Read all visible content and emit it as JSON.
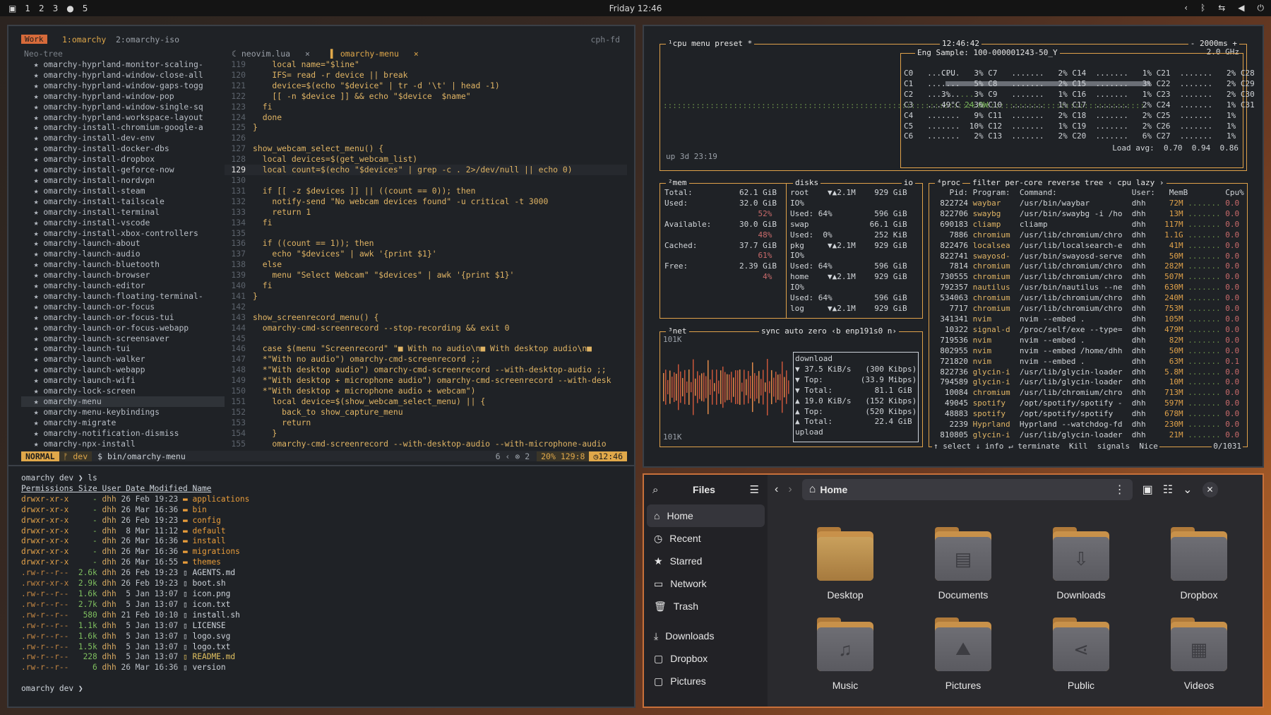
{
  "topbar": {
    "workspaces": [
      "1",
      "2",
      "3",
      "●",
      "5"
    ],
    "clock": "Friday 12:46",
    "tray": [
      "‹",
      "ᛒ",
      "⇆",
      "◀",
      "⏻"
    ]
  },
  "nvim": {
    "session_label": "Work",
    "window1": "1:omarchy",
    "window2": "2:omarchy-iso",
    "host": "cph-fd",
    "tree_title": "Neo-tree",
    "tabs": [
      {
        "label": "neovim.lua",
        "close": "×"
      },
      {
        "label": "omarchy-menu",
        "close": "×"
      }
    ],
    "tree": [
      "★ omarchy-hyprland-monitor-scaling-",
      "★ omarchy-hyprland-window-close-all",
      "★ omarchy-hyprland-window-gaps-togg",
      "★ omarchy-hyprland-window-pop",
      "★ omarchy-hyprland-window-single-sq",
      "★ omarchy-hyprland-workspace-layout",
      "★ omarchy-install-chromium-google-a",
      "★ omarchy-install-dev-env",
      "★ omarchy-install-docker-dbs",
      "★ omarchy-install-dropbox",
      "★ omarchy-install-geforce-now",
      "★ omarchy-install-nordvpn",
      "★ omarchy-install-steam",
      "★ omarchy-install-tailscale",
      "★ omarchy-install-terminal",
      "★ omarchy-install-vscode",
      "★ omarchy-install-xbox-controllers",
      "★ omarchy-launch-about",
      "★ omarchy-launch-audio",
      "★ omarchy-launch-bluetooth",
      "★ omarchy-launch-browser",
      "★ omarchy-launch-editor",
      "★ omarchy-launch-floating-terminal-",
      "★ omarchy-launch-or-focus",
      "★ omarchy-launch-or-focus-tui",
      "★ omarchy-launch-or-focus-webapp",
      "★ omarchy-launch-screensaver",
      "★ omarchy-launch-tui",
      "★ omarchy-launch-walker",
      "★ omarchy-launch-webapp",
      "★ omarchy-launch-wifi",
      "★ omarchy-lock-screen",
      "★ omarchy-menu",
      "★ omarchy-menu-keybindings",
      "★ omarchy-migrate",
      "★ omarchy-notification-dismiss",
      "★ omarchy-npx-install"
    ],
    "code": [
      {
        "n": "119",
        "t": "    local name=\"$line\""
      },
      {
        "n": "120",
        "t": "    IFS= read -r device || break"
      },
      {
        "n": "121",
        "t": "    device=$(echo \"$device\" | tr -d '\\t' | head -1)"
      },
      {
        "n": "122",
        "t": "    [[ -n $device ]] && echo \"$device  $name\""
      },
      {
        "n": "123",
        "t": "  fi"
      },
      {
        "n": "124",
        "t": "  done"
      },
      {
        "n": "125",
        "t": "}"
      },
      {
        "n": "126",
        "t": ""
      },
      {
        "n": "127",
        "t": "show_webcam_select_menu() {"
      },
      {
        "n": "128",
        "t": "  local devices=$(get_webcam_list)"
      },
      {
        "n": "129",
        "t": "  local count=$(echo \"$devices\" | grep -c . 2>/dev/null || echo 0)"
      },
      {
        "n": "130",
        "t": ""
      },
      {
        "n": "131",
        "t": "  if [[ -z $devices ]] || ((count == 0)); then"
      },
      {
        "n": "132",
        "t": "    notify-send \"No webcam devices found\" -u critical -t 3000"
      },
      {
        "n": "133",
        "t": "    return 1"
      },
      {
        "n": "134",
        "t": "  fi"
      },
      {
        "n": "135",
        "t": ""
      },
      {
        "n": "136",
        "t": "  if ((count == 1)); then"
      },
      {
        "n": "137",
        "t": "    echo \"$devices\" | awk '{print $1}'"
      },
      {
        "n": "138",
        "t": "  else"
      },
      {
        "n": "139",
        "t": "    menu \"Select Webcam\" \"$devices\" | awk '{print $1}'"
      },
      {
        "n": "140",
        "t": "  fi"
      },
      {
        "n": "141",
        "t": "}"
      },
      {
        "n": "142",
        "t": ""
      },
      {
        "n": "143",
        "t": "show_screenrecord_menu() {"
      },
      {
        "n": "144",
        "t": "  omarchy-cmd-screenrecord --stop-recording && exit 0"
      },
      {
        "n": "145",
        "t": ""
      },
      {
        "n": "146",
        "t": "  case $(menu \"Screenrecord\" \"■ With no audio\\n■ With desktop audio\\n■"
      },
      {
        "n": "147",
        "t": "  *\"With no audio\") omarchy-cmd-screenrecord ;;"
      },
      {
        "n": "148",
        "t": "  *\"With desktop audio\") omarchy-cmd-screenrecord --with-desktop-audio ;;"
      },
      {
        "n": "149",
        "t": "  *\"With desktop + microphone audio\") omarchy-cmd-screenrecord --with-desk"
      },
      {
        "n": "150",
        "t": "  *\"With desktop + microphone audio + webcam\")"
      },
      {
        "n": "151",
        "t": "    local device=$(show_webcam_select_menu) || {"
      },
      {
        "n": "152",
        "t": "      back_to show_capture_menu"
      },
      {
        "n": "153",
        "t": "      return"
      },
      {
        "n": "154",
        "t": "    }"
      },
      {
        "n": "155",
        "t": "    omarchy-cmd-screenrecord --with-desktop-audio --with-microphone-audio"
      }
    ],
    "status": {
      "mode": "NORMAL",
      "branch": "ᚠ dev",
      "file": "$  bin/omarchy-menu",
      "diag": "6 ‹ ⊗ 2",
      "pos": "20%  129:8",
      "time": "12:46"
    }
  },
  "terminal": {
    "prompt1": "omarchy dev ❯ ls",
    "headers": [
      "Permissions",
      "Size",
      "User",
      "Date Modified",
      "Name"
    ],
    "rows": [
      [
        "drwxr-xr-x",
        "-",
        "dhh",
        "26 Feb 19:23",
        "applications"
      ],
      [
        "drwxr-xr-x",
        "-",
        "dhh",
        "26 Mar 16:36",
        "bin"
      ],
      [
        "drwxr-xr-x",
        "-",
        "dhh",
        "26 Feb 19:23",
        "config"
      ],
      [
        "drwxr-xr-x",
        "-",
        "dhh",
        " 8 Mar 11:12",
        "default"
      ],
      [
        "drwxr-xr-x",
        "-",
        "dhh",
        "26 Mar 16:36",
        "install"
      ],
      [
        "drwxr-xr-x",
        "-",
        "dhh",
        "26 Mar 16:36",
        "migrations"
      ],
      [
        "drwxr-xr-x",
        "-",
        "dhh",
        "26 Mar 16:55",
        "themes"
      ],
      [
        ".rw-r--r--",
        "2.6k",
        "dhh",
        "26 Feb 19:23",
        "AGENTS.md"
      ],
      [
        ".rwxr-xr-x",
        "2.9k",
        "dhh",
        "26 Feb 19:23",
        "boot.sh"
      ],
      [
        ".rw-r--r--",
        "1.6k",
        "dhh",
        " 5 Jan 13:07",
        "icon.png"
      ],
      [
        ".rw-r--r--",
        "2.7k",
        "dhh",
        " 5 Jan 13:07",
        "icon.txt"
      ],
      [
        ".rw-r--r--",
        "580",
        "dhh",
        "21 Feb 10:10",
        "install.sh"
      ],
      [
        ".rw-r--r--",
        "1.1k",
        "dhh",
        " 5 Jan 13:07",
        "LICENSE"
      ],
      [
        ".rw-r--r--",
        "1.6k",
        "dhh",
        " 5 Jan 13:07",
        "logo.svg"
      ],
      [
        ".rw-r--r--",
        "1.5k",
        "dhh",
        " 5 Jan 13:07",
        "logo.txt"
      ],
      [
        ".rw-r--r--",
        "228",
        "dhh",
        " 5 Jan 13:07",
        "README.md"
      ],
      [
        ".rw-r--r--",
        "6",
        "dhh",
        "26 Mar 16:36",
        "version"
      ]
    ],
    "prompt2": "omarchy dev ❯"
  },
  "btop": {
    "cpu_title": "¹cpu",
    "menu_label": "menu",
    "preset_label": "preset *",
    "time": "12:46:42",
    "interval": "- 2000ms +",
    "freq": "2.0 GHz",
    "cpu_model": "Eng Sample: 100-000001243-50_Y",
    "cpu_total": "CPU",
    "cpu_pct": "3%",
    "cpu_temp": "49°C",
    "cpu_power": "24.0W",
    "cores": [
      [
        "C0",
        "3%",
        "C7",
        "2%",
        "C14",
        "1%",
        "C21",
        "2%",
        "C28",
        "1%"
      ],
      [
        "C1",
        "5%",
        "C8",
        "2%",
        "C15",
        "3%",
        "C22",
        "2%",
        "C29",
        "2%"
      ],
      [
        "C2",
        "3%",
        "C9",
        "1%",
        "C16",
        "1%",
        "C23",
        "2%",
        "C30",
        "2%"
      ],
      [
        "C3",
        "3%",
        "C10",
        "1%",
        "C17",
        "2%",
        "C24",
        "1%",
        "C31",
        "2%"
      ],
      [
        "C4",
        "9%",
        "C11",
        "2%",
        "C18",
        "2%",
        "C25",
        "1%",
        "",
        ""
      ],
      [
        "C5",
        "10%",
        "C12",
        "1%",
        "C19",
        "2%",
        "C26",
        "1%",
        "",
        ""
      ],
      [
        "C6",
        "2%",
        "C13",
        "2%",
        "C20",
        "6%",
        "C27",
        "1%",
        "",
        ""
      ]
    ],
    "loadavg": "Load avg:  0.70  0.94  0.86",
    "uptime": "up 3d 23:19",
    "mem_title": "²mem",
    "mem": [
      "Total:          62.1 GiB",
      "Used:           32.0 GiB",
      "                    52%",
      "Available:      30.0 GiB",
      "                    48%",
      "Cached:         37.7 GiB",
      "                    61%",
      "Free:           2.39 GiB",
      "                     4%"
    ],
    "disks_title": "disks",
    "io_label": "io",
    "disks": [
      "root    ▼▲2.1M    929 GiB",
      "IO%",
      "Used: 64%         596 GiB",
      "swap             66.1 GiB",
      "Used:  0%         252 KiB",
      "pkg     ▼▲2.1M    929 GiB",
      "IO%",
      "Used: 64%         596 GiB",
      "home    ▼▲2.1M    929 GiB",
      "IO%",
      "Used: 64%         596 GiB",
      "log     ▼▲2.1M    929 GiB"
    ],
    "net_title": "³net",
    "net_opts": "sync auto zero ‹b enp191s0 n›",
    "net_scale": "101K",
    "net_scale2": "101K",
    "net": [
      "download",
      "▼ 37.5 KiB/s   (300 Kibps)",
      "▼ Top:        (33.9 Mibps)",
      "▼ Total:         81.1 GiB",
      "",
      "▲ 19.0 KiB/s   (152 Kibps)",
      "▲ Top:         (520 Kibps)",
      "▲ Total:         22.4 GiB",
      "upload"
    ],
    "proc_title": "⁴proc",
    "proc_opts": "filter   per-core reverse tree ‹ cpu lazy ›",
    "proc_header": "    Pid: Program:  Command:                User:   MemB        Cpu%",
    "procs": [
      [
        "822724",
        "waybar",
        "/usr/bin/waybar",
        "dhh",
        "72M",
        "0.0"
      ],
      [
        "822706",
        "swaybg",
        "/usr/bin/swaybg -i /ho",
        "dhh",
        "13M",
        "0.0"
      ],
      [
        "690183",
        "cliamp",
        "cliamp",
        "dhh",
        "117M",
        "0.0"
      ],
      [
        "7886",
        "chromium",
        "/usr/lib/chromium/chro",
        "dhh",
        "1.1G",
        "0.0"
      ],
      [
        "822476",
        "localsea",
        "/usr/lib/localsearch-e",
        "dhh",
        "41M",
        "0.0"
      ],
      [
        "822741",
        "swayosd-",
        "/usr/bin/swayosd-serve",
        "dhh",
        "50M",
        "0.0"
      ],
      [
        "7814",
        "chromium",
        "/usr/lib/chromium/chro",
        "dhh",
        "282M",
        "0.0"
      ],
      [
        "730555",
        "chromium",
        "/usr/lib/chromium/chro",
        "dhh",
        "507M",
        "0.0"
      ],
      [
        "792357",
        "nautilus",
        "/usr/bin/nautilus --ne",
        "dhh",
        "630M",
        "0.0"
      ],
      [
        "534063",
        "chromium",
        "/usr/lib/chromium/chro",
        "dhh",
        "240M",
        "0.0"
      ],
      [
        "7717",
        "chromium",
        "/usr/lib/chromium/chro",
        "dhh",
        "753M",
        "0.0"
      ],
      [
        "341341",
        "nvim",
        "nvim --embed .",
        "dhh",
        "105M",
        "0.0"
      ],
      [
        "10322",
        "signal-d",
        "/proc/self/exe --type=",
        "dhh",
        "479M",
        "0.0"
      ],
      [
        "719536",
        "nvim",
        "nvim --embed .",
        "dhh",
        "82M",
        "0.0"
      ],
      [
        "802955",
        "nvim",
        "nvim --embed /home/dhh",
        "dhh",
        "50M",
        "0.0"
      ],
      [
        "721820",
        "nvim",
        "nvim --embed .",
        "dhh",
        "63M",
        "0.1"
      ],
      [
        "822736",
        "glycin-i",
        "/usr/lib/glycin-loader",
        "dhh",
        "5.8M",
        "0.0"
      ],
      [
        "794589",
        "glycin-i",
        "/usr/lib/glycin-loader",
        "dhh",
        "10M",
        "0.0"
      ],
      [
        "10084",
        "chromium",
        "/usr/lib/chromium/chro",
        "dhh",
        "713M",
        "0.0"
      ],
      [
        "49045",
        "spotify",
        "/opt/spotify/spotify -",
        "dhh",
        "597M",
        "0.0"
      ],
      [
        "48883",
        "spotify",
        "/opt/spotify/spotify",
        "dhh",
        "678M",
        "0.0"
      ],
      [
        "2239",
        "Hyprland",
        "Hyprland --watchdog-fd",
        "dhh",
        "230M",
        "0.0"
      ],
      [
        "810805",
        "glycin-i",
        "/usr/lib/glycin-loader",
        "dhh",
        "21M",
        "0.0"
      ]
    ],
    "proc_footer": "↑ select ↓ info ↵ terminate  Kill  signals  Nice",
    "proc_count": "0/1031"
  },
  "files": {
    "title": "Files",
    "path": "Home",
    "sidebar": [
      {
        "icon": "⌂",
        "label": "Home"
      },
      {
        "icon": "◷",
        "label": "Recent"
      },
      {
        "icon": "★",
        "label": "Starred"
      },
      {
        "icon": "▭",
        "label": "Network"
      },
      {
        "icon": "🗑",
        "label": "Trash"
      },
      {
        "icon": "⤓",
        "label": "Downloads"
      },
      {
        "icon": "▢",
        "label": "Dropbox"
      },
      {
        "icon": "▢",
        "label": "Pictures"
      }
    ],
    "folders": [
      {
        "label": "Desktop",
        "glyph": ""
      },
      {
        "label": "Documents",
        "glyph": "▤"
      },
      {
        "label": "Downloads",
        "glyph": "⇩"
      },
      {
        "label": "Dropbox",
        "glyph": ""
      },
      {
        "label": "Music",
        "glyph": "♫"
      },
      {
        "label": "Pictures",
        "glyph": "⛰"
      },
      {
        "label": "Public",
        "glyph": "⋖"
      },
      {
        "label": "Videos",
        "glyph": "▦"
      }
    ]
  }
}
